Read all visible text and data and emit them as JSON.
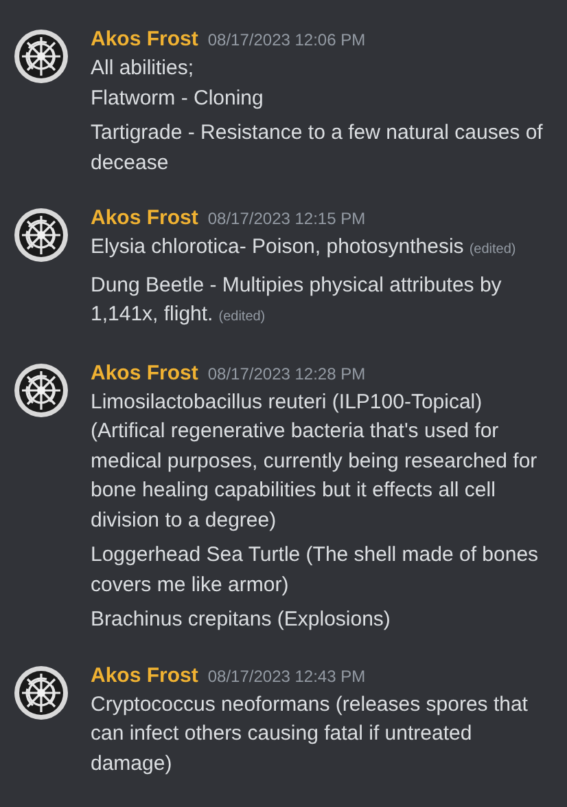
{
  "messages": [
    {
      "author": "Akos Frost",
      "timestamp": "08/17/2023 12:06 PM",
      "lines": [
        {
          "text": "All abilities;\nFlatworm - Cloning",
          "edited": false
        },
        {
          "text": "Tartigrade - Resistance to a few natural causes of decease",
          "edited": false
        }
      ]
    },
    {
      "author": "Akos Frost",
      "timestamp": "08/17/2023 12:15 PM",
      "lines": [
        {
          "text": "Elysia chlorotica- Poison, photosynthesis",
          "edited": true,
          "edited_label": "(edited)"
        },
        {
          "text": "Dung Beetle - Multipies physical attributes by 1,141x, flight.",
          "edited": true,
          "edited_label": "(edited)"
        }
      ]
    },
    {
      "author": "Akos Frost",
      "timestamp": "08/17/2023 12:28 PM",
      "lines": [
        {
          "text": "Limosilactobacillus reuteri (ILP100-Topical) (Artifical regenerative bacteria that's used for medical purposes, currently being researched for bone healing capabilities but it effects all cell division to a degree)",
          "edited": false
        },
        {
          "text": "Loggerhead Sea Turtle (The shell made of bones covers me like armor)",
          "edited": false
        },
        {
          "text": "Brachinus crepitans (Explosions)",
          "edited": false
        }
      ]
    },
    {
      "author": "Akos Frost",
      "timestamp": "08/17/2023 12:43 PM",
      "lines": [
        {
          "text": "Cryptococcus neoformans (releases spores that can infect others causing fatal if untreated damage)",
          "edited": false
        }
      ]
    }
  ]
}
